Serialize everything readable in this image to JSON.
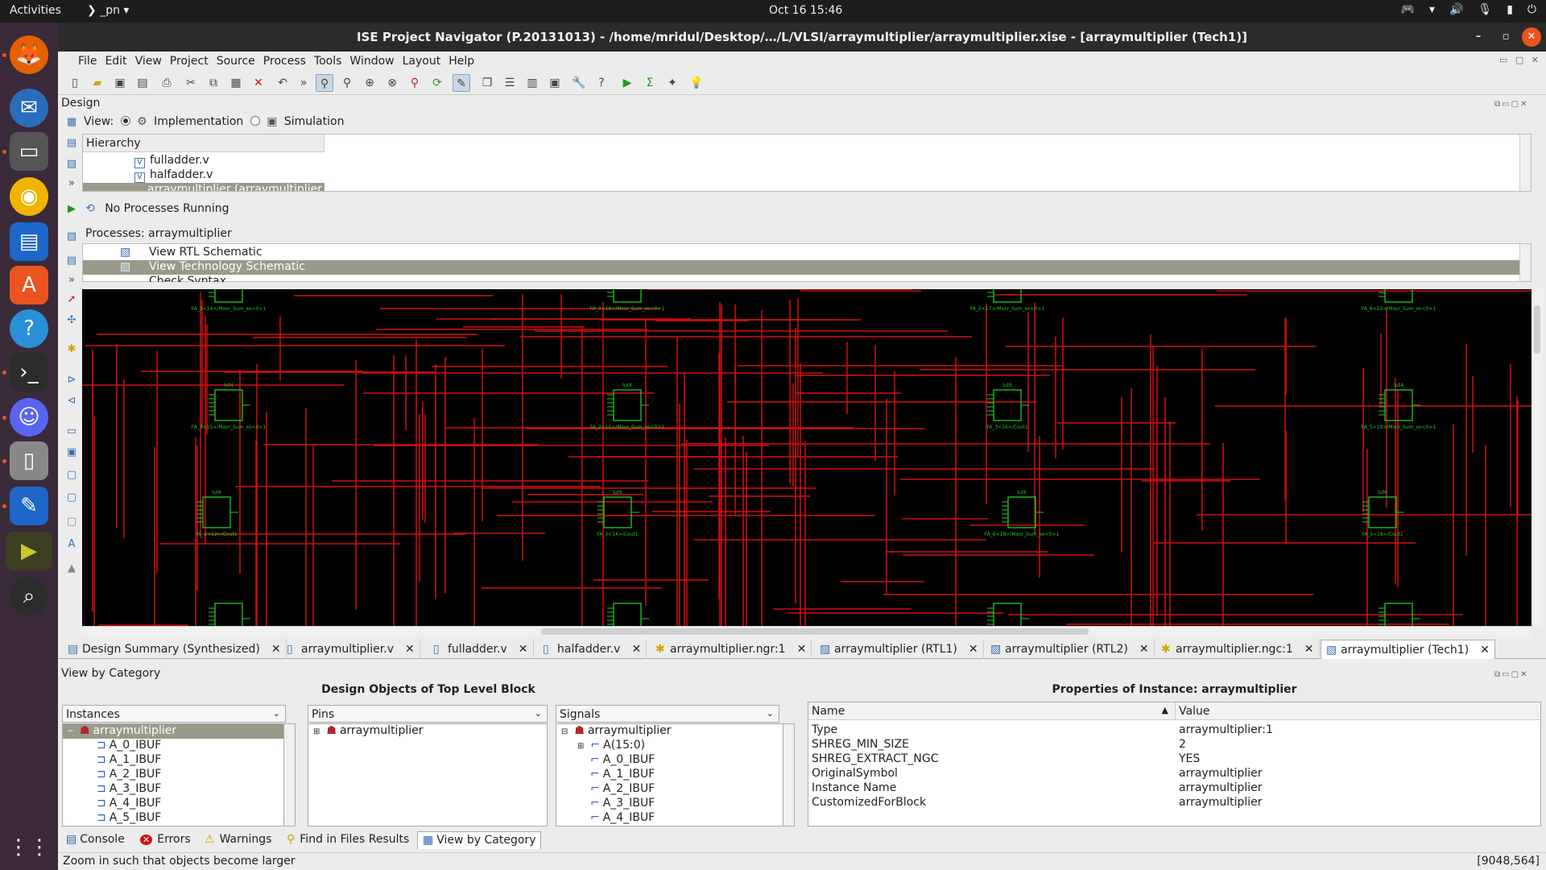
{
  "topbar": {
    "activities": "Activities",
    "app": "_pn",
    "clock": "Oct 16  15:46"
  },
  "window": {
    "title": "ISE Project Navigator (P.20131013) - /home/mridul/Desktop/…/L/VLSI/arraymultiplier/arraymultiplier.xise - [arraymultiplier (Tech1)]"
  },
  "menu": [
    "File",
    "Edit",
    "View",
    "Project",
    "Source",
    "Process",
    "Tools",
    "Window",
    "Layout",
    "Help"
  ],
  "design": {
    "label": "Design",
    "view_label": "View:",
    "view_impl": "Implementation",
    "view_sim": "Simulation",
    "hierarchy_header": "Hierarchy",
    "files": [
      "fulladder.v",
      "halfadder.v",
      "arraymultiplier (arraymultiplier.v)"
    ],
    "no_process": "No Processes Running",
    "processes_title": "Processes: arraymultiplier",
    "processes": [
      "View RTL Schematic",
      "View Technology Schematic",
      "Check Syntax"
    ]
  },
  "schematic": {
    "labels": [
      "FA_3<14>/Mxor_Sum_xo<0>1",
      "FA_3<16>/Mxor_Sum_xo<0>1",
      "FA_2<17>/Mxor_Sum_xo<0>1",
      "FA_6<20>/Mxor_Sum_xo<0>1",
      "FA_3<15>/Mxor_Sum_xo<0>1",
      "FA_2<15>/Mxor_Sum_xo<0>1",
      "FA_3<16>/Cout1",
      "FA_5<19>/Mxor_Sum_xo<0>1",
      "FA_2<12>/Cout1",
      "FA_3<14>/Cout1",
      "FA_6<18>/Mxor_Sum_xo<0>1",
      "FA_5<18>/Cout1"
    ],
    "lut_names": [
      "lut4",
      "lut4",
      "lut4",
      "lut4",
      "lut4",
      "lut4",
      "lut6",
      "lut4",
      "lut6",
      "lut6",
      "lut6",
      "lut6",
      "lut6",
      "lut6",
      "lut4",
      "lut6"
    ]
  },
  "editor_tabs": [
    "Design Summary (Synthesized)",
    "arraymultiplier.v",
    "fulladder.v",
    "halfadder.v",
    "arraymultiplier.ngr:1",
    "arraymultiplier (RTL1)",
    "arraymultiplier (RTL2)",
    "arraymultiplier.ngc:1",
    "arraymultiplier (Tech1)"
  ],
  "bottom": {
    "view_by_category": "View by Category",
    "design_objects_title": "Design Objects of Top Level Block",
    "properties_title": "Properties of Instance: arraymultiplier",
    "instances_combo": "Instances",
    "pins_combo": "Pins",
    "signals_combo": "Signals",
    "instances": [
      "arraymultiplier",
      "A_0_IBUF",
      "A_1_IBUF",
      "A_2_IBUF",
      "A_3_IBUF",
      "A_4_IBUF",
      "A_5_IBUF"
    ],
    "pins": [
      "arraymultiplier"
    ],
    "signals": [
      "arraymultiplier",
      "A(15:0)",
      "A_0_IBUF",
      "A_1_IBUF",
      "A_2_IBUF",
      "A_3_IBUF",
      "A_4_IBUF"
    ],
    "prop_name_header": "Name",
    "prop_value_header": "Value",
    "properties": [
      {
        "name": "Type",
        "value": "arraymultiplier:1"
      },
      {
        "name": "SHREG_MIN_SIZE",
        "value": "2"
      },
      {
        "name": "SHREG_EXTRACT_NGC",
        "value": "YES"
      },
      {
        "name": "OriginalSymbol",
        "value": "arraymultiplier"
      },
      {
        "name": "Instance Name",
        "value": "arraymultiplier"
      },
      {
        "name": "CustomizedForBlock",
        "value": "arraymultiplier"
      }
    ]
  },
  "bottom_tabs": [
    "Console",
    "Errors",
    "Warnings",
    "Find in Files Results",
    "View by Category"
  ],
  "status": {
    "message": "Zoom in such that objects become larger",
    "coords": "[9048,564]"
  },
  "colors": {
    "wire": "#d01010",
    "component": "#22cc22",
    "schematic_bg": "#000000",
    "selection": "#9a9a8a"
  }
}
